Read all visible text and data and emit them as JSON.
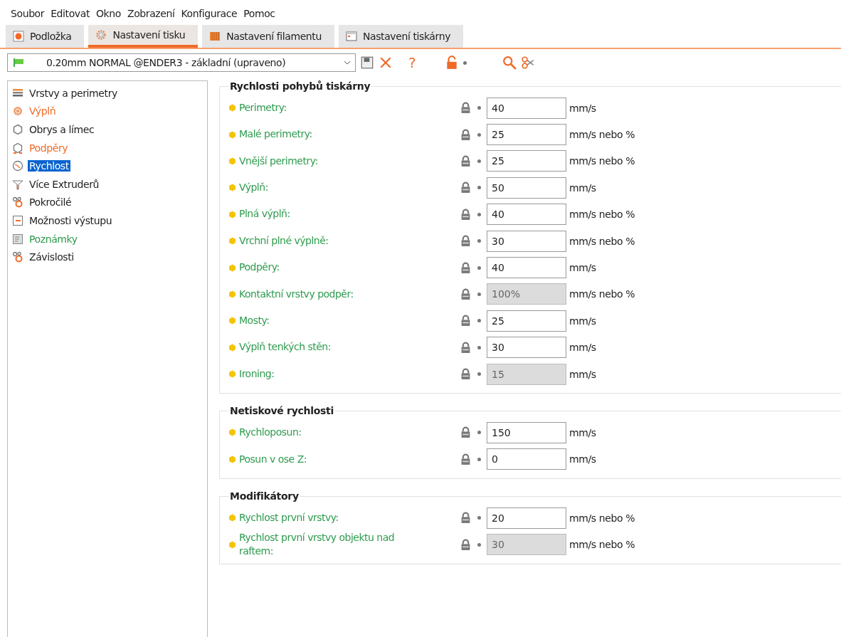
{
  "menu": [
    "Soubor",
    "Editovat",
    "Okno",
    "Zobrazení",
    "Konfigurace",
    "Pomoc"
  ],
  "tabs": [
    {
      "label": "Podložka",
      "kind": "bed",
      "selected": false
    },
    {
      "label": "Nastavení tisku",
      "kind": "gear",
      "selected": true
    },
    {
      "label": "Nastavení filamentu",
      "kind": "spool",
      "selected": false
    },
    {
      "label": "Nastavení tiskárny",
      "kind": "printer",
      "selected": false
    }
  ],
  "preset": {
    "value": "0.20mm NORMAL @ENDER3 - základní (upraveno)",
    "help": "?"
  },
  "sidebar": {
    "items": [
      {
        "label": "Vrstvy a perimetry",
        "kind": "layers",
        "color": "#222222",
        "selected": false
      },
      {
        "label": "Výplň",
        "kind": "infill",
        "color": "#f06a28",
        "selected": false
      },
      {
        "label": "Obrys a límec",
        "kind": "hex",
        "color": "#222222",
        "selected": false
      },
      {
        "label": "Podpěry",
        "kind": "support",
        "color": "#f06a28",
        "selected": false
      },
      {
        "label": "Rychlost",
        "kind": "clock",
        "selected": true
      },
      {
        "label": "Více Extruderů",
        "kind": "funnel",
        "color": "#222222",
        "selected": false
      },
      {
        "label": "Pokročilé",
        "kind": "cogs",
        "color": "#222222",
        "selected": false
      },
      {
        "label": "Možnosti výstupu",
        "kind": "output",
        "color": "#222222",
        "selected": false
      },
      {
        "label": "Poznámky",
        "kind": "notes",
        "color": "#2e9b4e",
        "selected": false
      },
      {
        "label": "Závislosti",
        "kind": "cogs",
        "color": "#222222",
        "selected": false
      }
    ]
  },
  "groups": [
    {
      "title": "Rychlosti pohybů tiskárny",
      "rows": [
        {
          "label": "Perimetry:",
          "value": "40",
          "unit": "mm/s",
          "disabled": false
        },
        {
          "label": "Malé perimetry:",
          "value": "25",
          "unit": "mm/s nebo %",
          "disabled": false
        },
        {
          "label": "Vnější perimetry:",
          "value": "25",
          "unit": "mm/s nebo %",
          "disabled": false
        },
        {
          "label": "Výplň:",
          "value": "50",
          "unit": "mm/s",
          "disabled": false
        },
        {
          "label": "Plná výplň:",
          "value": "40",
          "unit": "mm/s nebo %",
          "disabled": false
        },
        {
          "label": "Vrchní plné výplně:",
          "value": "30",
          "unit": "mm/s nebo %",
          "disabled": false
        },
        {
          "label": "Podpěry:",
          "value": "40",
          "unit": "mm/s",
          "disabled": false
        },
        {
          "label": "Kontaktní vrstvy podpěr:",
          "value": "100%",
          "unit": "mm/s nebo %",
          "disabled": true
        },
        {
          "label": "Mosty:",
          "value": "25",
          "unit": "mm/s",
          "disabled": false
        },
        {
          "label": "Výplň tenkých stěn:",
          "value": "30",
          "unit": "mm/s",
          "disabled": false
        },
        {
          "label": "Ironing:",
          "value": "15",
          "unit": "mm/s",
          "disabled": true
        }
      ]
    },
    {
      "title": "Netiskové rychlosti",
      "rows": [
        {
          "label": "Rychloposun:",
          "value": "150",
          "unit": "mm/s",
          "disabled": false
        },
        {
          "label": "Posun v ose Z:",
          "value": "0",
          "unit": "mm/s",
          "disabled": false
        }
      ]
    },
    {
      "title": "Modifikátory",
      "rows": [
        {
          "label": "Rychlost první vrstvy:",
          "value": "20",
          "unit": "mm/s nebo %",
          "disabled": false
        },
        {
          "label": "Rychlost první vrstvy objektu nad raftem:",
          "value": "30",
          "unit": "mm/s nebo %",
          "disabled": true
        }
      ]
    }
  ]
}
